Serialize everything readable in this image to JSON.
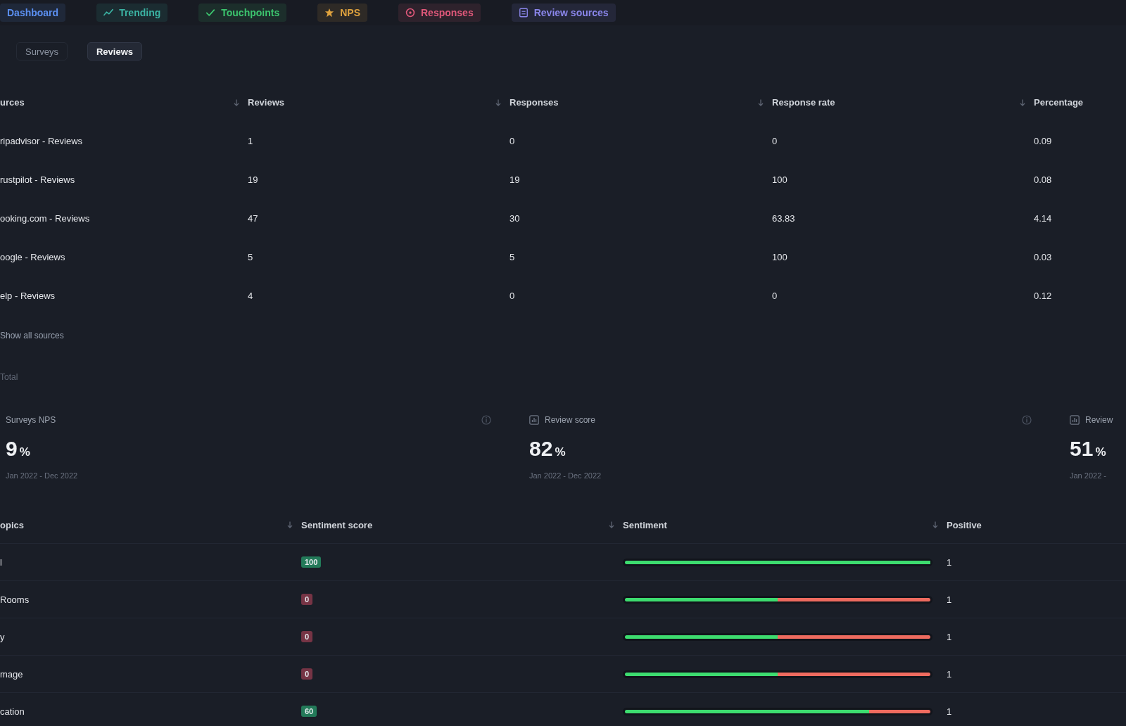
{
  "nav": [
    {
      "label": "Dashboard",
      "color": "#5b8ff0"
    },
    {
      "label": "Trending",
      "color": "#3bb3a3"
    },
    {
      "label": "Touchpoints",
      "color": "#3cc46e"
    },
    {
      "label": "NPS",
      "color": "#e0a33e"
    },
    {
      "label": "Responses",
      "color": "#e0587a"
    },
    {
      "label": "Review sources",
      "color": "#8a86ea"
    }
  ],
  "subtabs": [
    {
      "label": "Surveys",
      "selected": false
    },
    {
      "label": "Reviews",
      "selected": true
    }
  ],
  "sources_table": {
    "columns": [
      "urces",
      "Reviews",
      "Responses",
      "Response rate",
      "Percentage"
    ],
    "rows": [
      [
        "ripadvisor - Reviews",
        "1",
        "0",
        "0",
        "0.09"
      ],
      [
        "rustpilot - Reviews",
        "19",
        "19",
        "100",
        "0.08"
      ],
      [
        "ooking.com - Reviews",
        "47",
        "30",
        "63.83",
        "4.14"
      ],
      [
        "oogle - Reviews",
        "5",
        "5",
        "100",
        "0.03"
      ],
      [
        "elp - Reviews",
        "4",
        "0",
        "0",
        "0.12"
      ]
    ],
    "expand_link": "Show all sources",
    "footer": "Total"
  },
  "kpis": [
    {
      "label": "Surveys NPS",
      "value": "9",
      "unit": "%",
      "period": "Jan 2022 - Dec 2022"
    },
    {
      "label": "Review score",
      "value": "82",
      "unit": "%",
      "period": "Jan 2022 - Dec 2022"
    },
    {
      "label": "Review",
      "value": "51",
      "unit": "%",
      "period": "Jan 2022 -"
    }
  ],
  "topics_table": {
    "columns": [
      "opics",
      "Sentiment score",
      "Sentiment",
      "Positive"
    ],
    "rows": [
      {
        "topic": "l",
        "score": "100",
        "color": "#237a59",
        "level": 1,
        "positive": "1"
      },
      {
        "topic": "Rooms",
        "score": "0",
        "color": "#763445",
        "level": 0.5,
        "positive": "1"
      },
      {
        "topic": "y",
        "score": "0",
        "color": "#763445",
        "level": 0.5,
        "positive": "1"
      },
      {
        "topic": "mage",
        "score": "0",
        "color": "#763445",
        "level": 0.5,
        "positive": "1"
      },
      {
        "topic": "cation",
        "score": "60",
        "color": "#237a59",
        "level": 0.8,
        "positive": "1"
      }
    ]
  }
}
